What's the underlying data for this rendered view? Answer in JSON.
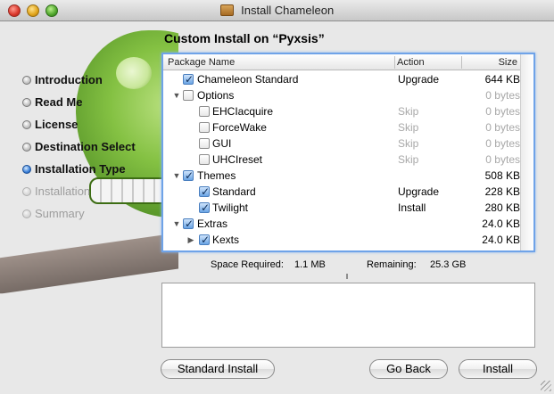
{
  "window": {
    "title": "Install Chameleon"
  },
  "sidebar": {
    "steps": [
      {
        "label": "Introduction",
        "state": "done"
      },
      {
        "label": "Read Me",
        "state": "done"
      },
      {
        "label": "License",
        "state": "done"
      },
      {
        "label": "Destination Select",
        "state": "done"
      },
      {
        "label": "Installation Type",
        "state": "active"
      },
      {
        "label": "Installation",
        "state": "todo"
      },
      {
        "label": "Summary",
        "state": "todo"
      }
    ]
  },
  "main": {
    "heading": "Custom Install on “Pyxsis”",
    "table": {
      "columns": {
        "name": "Package Name",
        "action": "Action",
        "size": "Size"
      },
      "rows": [
        {
          "name": "Chameleon Standard",
          "action": "Upgrade",
          "size": "644 KB",
          "checked": true,
          "level": 0,
          "expander": "none"
        },
        {
          "name": "Options",
          "action": "",
          "size": "0 bytes",
          "checked": false,
          "level": 0,
          "expander": "open"
        },
        {
          "name": "EHCIacquire",
          "action": "Skip",
          "size": "0 bytes",
          "checked": false,
          "level": 1,
          "expander": "none"
        },
        {
          "name": "ForceWake",
          "action": "Skip",
          "size": "0 bytes",
          "checked": false,
          "level": 1,
          "expander": "none"
        },
        {
          "name": "GUI",
          "action": "Skip",
          "size": "0 bytes",
          "checked": false,
          "level": 1,
          "expander": "none"
        },
        {
          "name": "UHCIreset",
          "action": "Skip",
          "size": "0 bytes",
          "checked": false,
          "level": 1,
          "expander": "none"
        },
        {
          "name": "Themes",
          "action": "",
          "size": "508 KB",
          "checked": true,
          "level": 0,
          "expander": "open"
        },
        {
          "name": "Standard",
          "action": "Upgrade",
          "size": "228 KB",
          "checked": true,
          "level": 1,
          "expander": "none"
        },
        {
          "name": "Twilight",
          "action": "Install",
          "size": "280 KB",
          "checked": true,
          "level": 1,
          "expander": "none"
        },
        {
          "name": "Extras",
          "action": "",
          "size": "24.0 KB",
          "checked": true,
          "level": 0,
          "expander": "open"
        },
        {
          "name": "Kexts",
          "action": "",
          "size": "24.0 KB",
          "checked": true,
          "level": 1,
          "expander": "closed"
        }
      ]
    },
    "space": {
      "required_label": "Space Required:",
      "required_value": "1.1 MB",
      "remaining_label": "Remaining:",
      "remaining_value": "25.3 GB"
    },
    "buttons": {
      "standard_install": "Standard Install",
      "go_back": "Go Back",
      "install": "Install"
    }
  }
}
